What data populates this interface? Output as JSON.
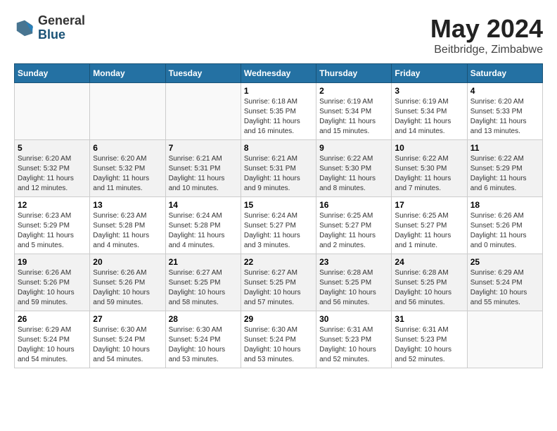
{
  "header": {
    "logo_general": "General",
    "logo_blue": "Blue",
    "month_year": "May 2024",
    "location": "Beitbridge, Zimbabwe"
  },
  "days_of_week": [
    "Sunday",
    "Monday",
    "Tuesday",
    "Wednesday",
    "Thursday",
    "Friday",
    "Saturday"
  ],
  "weeks": [
    [
      {
        "day": "",
        "info": ""
      },
      {
        "day": "",
        "info": ""
      },
      {
        "day": "",
        "info": ""
      },
      {
        "day": "1",
        "info": "Sunrise: 6:18 AM\nSunset: 5:35 PM\nDaylight: 11 hours and 16 minutes."
      },
      {
        "day": "2",
        "info": "Sunrise: 6:19 AM\nSunset: 5:34 PM\nDaylight: 11 hours and 15 minutes."
      },
      {
        "day": "3",
        "info": "Sunrise: 6:19 AM\nSunset: 5:34 PM\nDaylight: 11 hours and 14 minutes."
      },
      {
        "day": "4",
        "info": "Sunrise: 6:20 AM\nSunset: 5:33 PM\nDaylight: 11 hours and 13 minutes."
      }
    ],
    [
      {
        "day": "5",
        "info": "Sunrise: 6:20 AM\nSunset: 5:32 PM\nDaylight: 11 hours and 12 minutes."
      },
      {
        "day": "6",
        "info": "Sunrise: 6:20 AM\nSunset: 5:32 PM\nDaylight: 11 hours and 11 minutes."
      },
      {
        "day": "7",
        "info": "Sunrise: 6:21 AM\nSunset: 5:31 PM\nDaylight: 11 hours and 10 minutes."
      },
      {
        "day": "8",
        "info": "Sunrise: 6:21 AM\nSunset: 5:31 PM\nDaylight: 11 hours and 9 minutes."
      },
      {
        "day": "9",
        "info": "Sunrise: 6:22 AM\nSunset: 5:30 PM\nDaylight: 11 hours and 8 minutes."
      },
      {
        "day": "10",
        "info": "Sunrise: 6:22 AM\nSunset: 5:30 PM\nDaylight: 11 hours and 7 minutes."
      },
      {
        "day": "11",
        "info": "Sunrise: 6:22 AM\nSunset: 5:29 PM\nDaylight: 11 hours and 6 minutes."
      }
    ],
    [
      {
        "day": "12",
        "info": "Sunrise: 6:23 AM\nSunset: 5:29 PM\nDaylight: 11 hours and 5 minutes."
      },
      {
        "day": "13",
        "info": "Sunrise: 6:23 AM\nSunset: 5:28 PM\nDaylight: 11 hours and 4 minutes."
      },
      {
        "day": "14",
        "info": "Sunrise: 6:24 AM\nSunset: 5:28 PM\nDaylight: 11 hours and 4 minutes."
      },
      {
        "day": "15",
        "info": "Sunrise: 6:24 AM\nSunset: 5:27 PM\nDaylight: 11 hours and 3 minutes."
      },
      {
        "day": "16",
        "info": "Sunrise: 6:25 AM\nSunset: 5:27 PM\nDaylight: 11 hours and 2 minutes."
      },
      {
        "day": "17",
        "info": "Sunrise: 6:25 AM\nSunset: 5:27 PM\nDaylight: 11 hours and 1 minute."
      },
      {
        "day": "18",
        "info": "Sunrise: 6:26 AM\nSunset: 5:26 PM\nDaylight: 11 hours and 0 minutes."
      }
    ],
    [
      {
        "day": "19",
        "info": "Sunrise: 6:26 AM\nSunset: 5:26 PM\nDaylight: 10 hours and 59 minutes."
      },
      {
        "day": "20",
        "info": "Sunrise: 6:26 AM\nSunset: 5:26 PM\nDaylight: 10 hours and 59 minutes."
      },
      {
        "day": "21",
        "info": "Sunrise: 6:27 AM\nSunset: 5:25 PM\nDaylight: 10 hours and 58 minutes."
      },
      {
        "day": "22",
        "info": "Sunrise: 6:27 AM\nSunset: 5:25 PM\nDaylight: 10 hours and 57 minutes."
      },
      {
        "day": "23",
        "info": "Sunrise: 6:28 AM\nSunset: 5:25 PM\nDaylight: 10 hours and 56 minutes."
      },
      {
        "day": "24",
        "info": "Sunrise: 6:28 AM\nSunset: 5:25 PM\nDaylight: 10 hours and 56 minutes."
      },
      {
        "day": "25",
        "info": "Sunrise: 6:29 AM\nSunset: 5:24 PM\nDaylight: 10 hours and 55 minutes."
      }
    ],
    [
      {
        "day": "26",
        "info": "Sunrise: 6:29 AM\nSunset: 5:24 PM\nDaylight: 10 hours and 54 minutes."
      },
      {
        "day": "27",
        "info": "Sunrise: 6:30 AM\nSunset: 5:24 PM\nDaylight: 10 hours and 54 minutes."
      },
      {
        "day": "28",
        "info": "Sunrise: 6:30 AM\nSunset: 5:24 PM\nDaylight: 10 hours and 53 minutes."
      },
      {
        "day": "29",
        "info": "Sunrise: 6:30 AM\nSunset: 5:24 PM\nDaylight: 10 hours and 53 minutes."
      },
      {
        "day": "30",
        "info": "Sunrise: 6:31 AM\nSunset: 5:23 PM\nDaylight: 10 hours and 52 minutes."
      },
      {
        "day": "31",
        "info": "Sunrise: 6:31 AM\nSunset: 5:23 PM\nDaylight: 10 hours and 52 minutes."
      },
      {
        "day": "",
        "info": ""
      }
    ]
  ]
}
